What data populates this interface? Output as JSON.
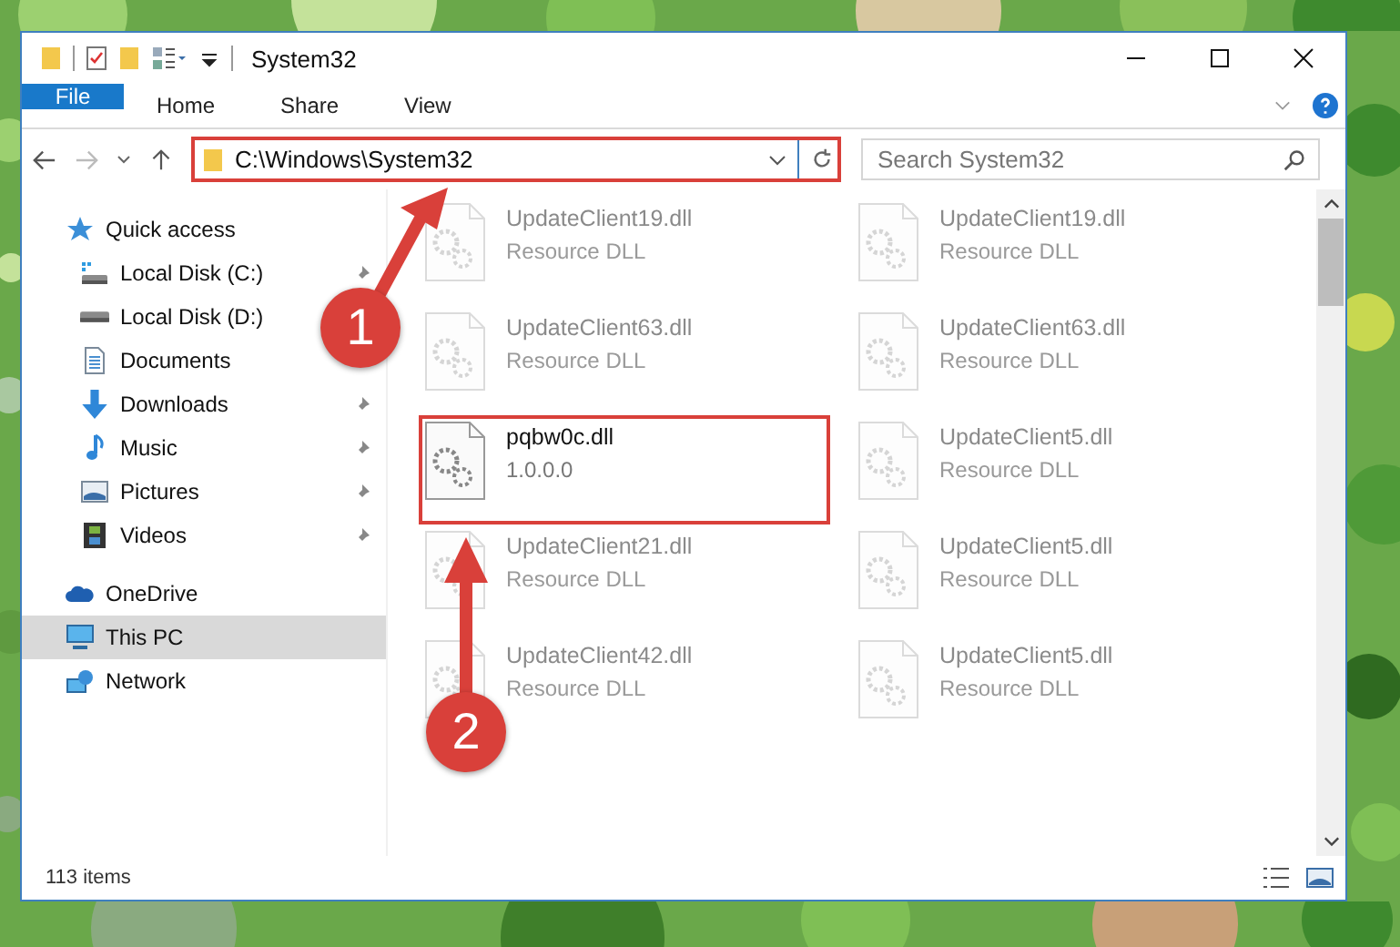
{
  "window": {
    "title": "System32"
  },
  "ribbon_tabs": [
    {
      "label": "File",
      "kind": "file"
    },
    {
      "label": "Home",
      "kind": "tab"
    },
    {
      "label": "Share",
      "kind": "tab"
    },
    {
      "label": "View",
      "kind": "tab"
    }
  ],
  "address": {
    "path": "C:\\Windows\\System32",
    "framed": true
  },
  "search": {
    "placeholder": "Search System32"
  },
  "sidebar": {
    "items": [
      {
        "label": "Quick access",
        "kind": "star",
        "selected": false,
        "children": [
          {
            "label": "Local Disk (C:)",
            "kind": "drive-system",
            "pinned": true,
            "selected": false
          },
          {
            "label": "Local Disk (D:)",
            "kind": "drive",
            "pinned": false,
            "selected": false
          },
          {
            "label": "Documents",
            "kind": "documents",
            "selected": false
          },
          {
            "label": "Downloads",
            "kind": "downloads",
            "pinned": true,
            "selected": false
          },
          {
            "label": "Music",
            "kind": "music",
            "pinned": true,
            "selected": false
          },
          {
            "label": "Pictures",
            "kind": "pictures",
            "pinned": true,
            "selected": false
          },
          {
            "label": "Videos",
            "kind": "videos",
            "pinned": true,
            "selected": false
          }
        ]
      },
      {
        "label": "OneDrive",
        "kind": "cloud",
        "selected": false
      },
      {
        "label": "This PC",
        "kind": "pc",
        "selected": true
      },
      {
        "label": "Network",
        "kind": "network",
        "selected": false
      }
    ]
  },
  "files": [
    {
      "name": "UpdateClient19.dll",
      "detail": "Resource DLL",
      "faded": true,
      "framed": false
    },
    {
      "name": "UpdateClient19.dll",
      "detail": "Resource DLL",
      "faded": true,
      "framed": false
    },
    {
      "name": "UpdateClient63.dll",
      "detail": "Resource DLL",
      "faded": true,
      "framed": false
    },
    {
      "name": "UpdateClient63.dll",
      "detail": "Resource DLL",
      "faded": true,
      "framed": false
    },
    {
      "name": "pqbw0c.dll",
      "detail": "1.0.0.0",
      "faded": false,
      "framed": true
    },
    {
      "name": "UpdateClient5.dll",
      "detail": "Resource DLL",
      "faded": true,
      "framed": false
    },
    {
      "name": "UpdateClient21.dll",
      "detail": "Resource DLL",
      "faded": true,
      "framed": false
    },
    {
      "name": "UpdateClient5.dll",
      "detail": "Resource DLL",
      "faded": true,
      "framed": false
    },
    {
      "name": "UpdateClient42.dll",
      "detail": "Resource DLL",
      "faded": true,
      "framed": false
    },
    {
      "name": "UpdateClient5.dll",
      "detail": "Resource DLL",
      "faded": true,
      "framed": false
    }
  ],
  "status_bar": {
    "item_count": "113 items"
  },
  "annotations": [
    {
      "number": "1"
    },
    {
      "number": "2"
    }
  ]
}
